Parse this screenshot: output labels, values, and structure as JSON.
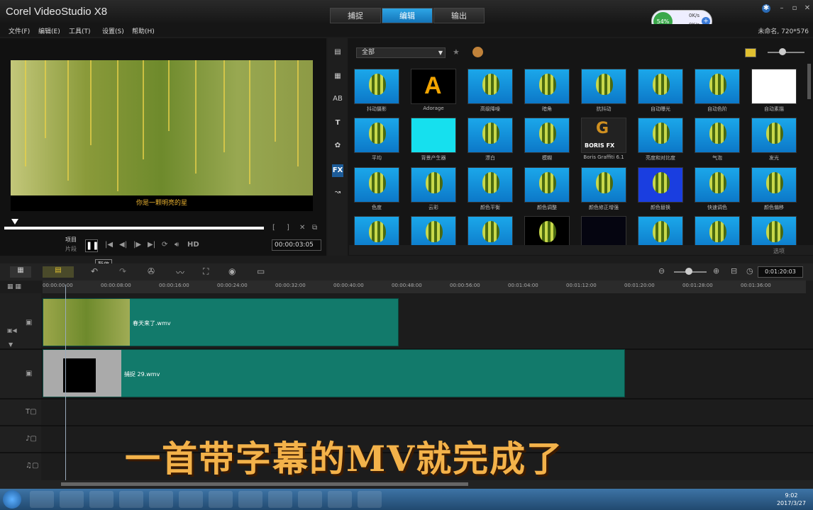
{
  "app": {
    "title": "Corel VideoStudio X8",
    "project_info": "未命名, 720*576"
  },
  "tabs": [
    {
      "label": "捕捉"
    },
    {
      "label": "编辑"
    },
    {
      "label": "输出"
    }
  ],
  "menu": [
    {
      "label": "文件(F)"
    },
    {
      "label": "编辑(E)"
    },
    {
      "label": "工具(T)"
    },
    {
      "label": "设置(S)"
    },
    {
      "label": "帮助(H)"
    }
  ],
  "netmon": {
    "percent": "54%",
    "up": "0K/s",
    "down": "0K/s"
  },
  "player": {
    "caption": "你是一颗明亮的星",
    "mode_project": "项目",
    "mode_clip": "片段",
    "hd": "HD",
    "timecode": "00:00:03:05",
    "tooltip": "暂停"
  },
  "library": {
    "category": "全部",
    "options": "选项",
    "thumbs": [
      [
        "抖动摄影",
        "Adorage",
        "高级降噪",
        "暗角",
        "抗抖动",
        "自动曝光",
        "自动色阶",
        "自动素描"
      ],
      [
        "平均",
        "背景产生器",
        "漂白",
        "模糊",
        "Boris Graffiti 6.1",
        "亮度和对比度",
        "气泡",
        "发光"
      ],
      [
        "色度",
        "云彩",
        "颜色平衡",
        "颜色调整",
        "颜色修正增强",
        "颜色替换",
        "快速调色",
        "颜色偏移"
      ],
      [
        "",
        "",
        "",
        "",
        "",
        "",
        "",
        ""
      ]
    ]
  },
  "timeline": {
    "zoom_time": "0:01:20:03",
    "ruler": [
      "00:00:00:00",
      "00:00:08:00",
      "00:00:16:00",
      "00:00:24:00",
      "00:00:32:00",
      "00:00:40:00",
      "00:00:48:00",
      "00:00:56:00",
      "00:01:04:00",
      "00:01:12:00",
      "00:01:20:00",
      "00:01:28:00",
      "00:01:36:00"
    ],
    "clip1": "春天来了.wmv",
    "clip2": "捕捉 29.wmv",
    "overlay_text": "一首带字幕的MV就完成了"
  },
  "clock": {
    "time": "9:02",
    "date": "2017/3/27"
  }
}
